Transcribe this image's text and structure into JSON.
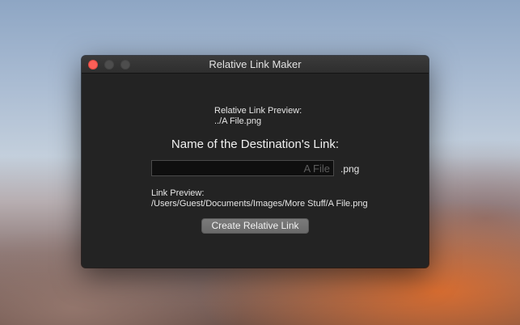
{
  "window": {
    "title": "Relative Link Maker",
    "controls": {
      "close": "close-icon",
      "minimize": "minimize-icon",
      "zoom": "zoom-icon"
    }
  },
  "relative_preview": {
    "label": "Relative Link Preview:",
    "value": "../A File.png"
  },
  "destination": {
    "heading": "Name of the Destination's Link:",
    "input_value": "",
    "input_placeholder": "A File",
    "extension": ".png"
  },
  "link_preview": {
    "label": "Link Preview:",
    "value": "/Users/Guest/Documents/Images/More Stuff/A File.png"
  },
  "actions": {
    "create_label": "Create Relative Link"
  },
  "colors": {
    "window_bg": "#232323",
    "close_button": "#fc5f57",
    "button_bg": "#707070"
  }
}
